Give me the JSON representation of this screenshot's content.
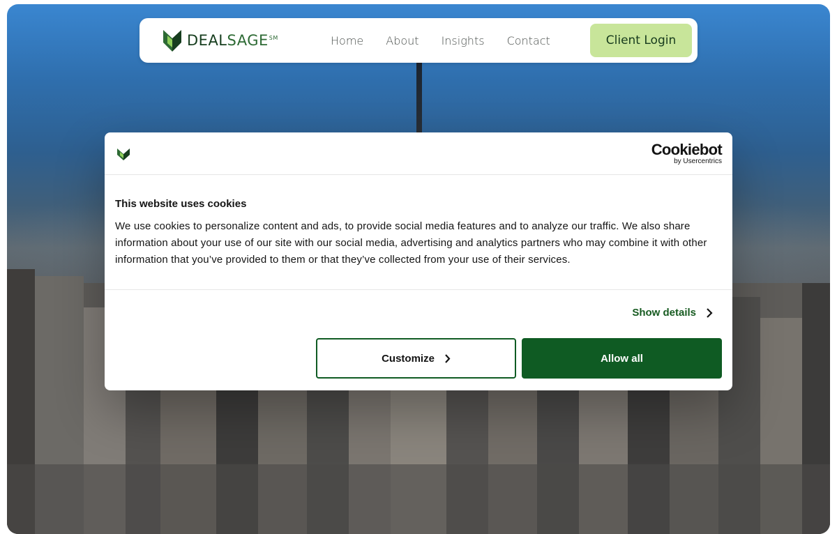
{
  "brand": {
    "name_part1": "DEAL",
    "name_part2": "SAGE",
    "mark": "SM",
    "colors": {
      "dark_green": "#163d1e",
      "green": "#2d6a34",
      "light_green": "#c8e59a"
    }
  },
  "nav": {
    "links": [
      {
        "label": "Home"
      },
      {
        "label": "About"
      },
      {
        "label": "Insights"
      },
      {
        "label": "Contact"
      }
    ],
    "login_label": "Client Login"
  },
  "cookie_dialog": {
    "provider_name": "Cookiebot",
    "provider_sub": "by Usercentrics",
    "title": "This website uses cookies",
    "body": "We use cookies to personalize content and ads, to provide social media features and to analyze our traffic. We also share information about your use of our site with our social media, advertising and analytics partners who may combine it with other information that you’ve provided to them or that they’ve collected from your use of their services.",
    "show_details_label": "Show details",
    "customize_label": "Customize",
    "allow_all_label": "Allow all",
    "accent_color": "#0f5b23"
  },
  "icons": {
    "brand_logo": "leaf-chevron-logo-icon",
    "details_chevron": "chevron-right-icon",
    "customize_chevron": "chevron-right-icon"
  }
}
